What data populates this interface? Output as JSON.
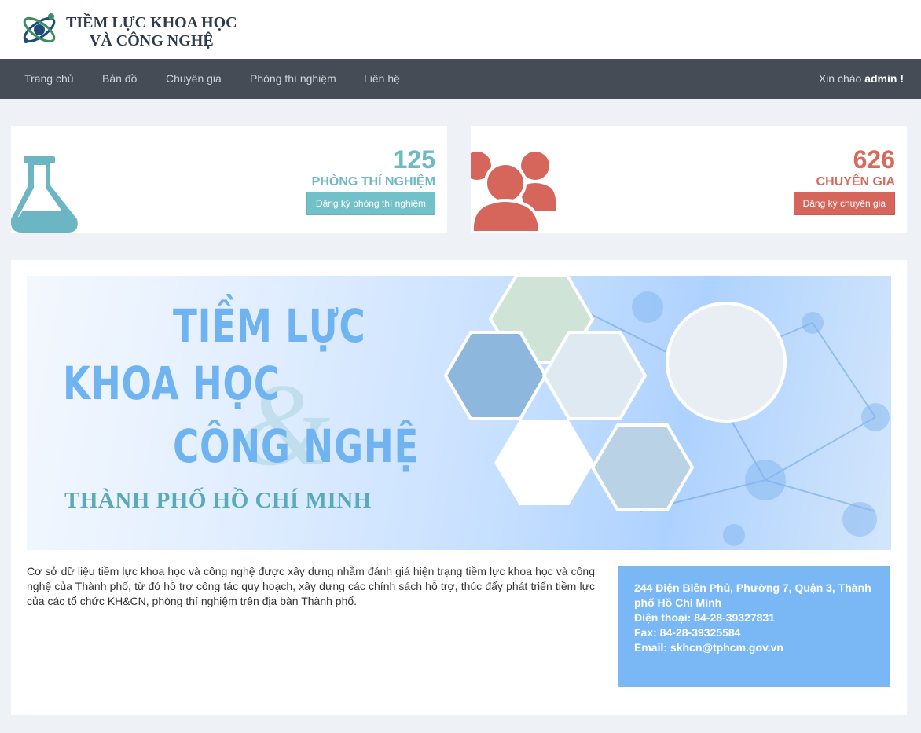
{
  "header": {
    "logo_line1": "TIỀM LỰC KHOA HỌC",
    "logo_line2": "VÀ CÔNG NGHỆ"
  },
  "nav": {
    "items": [
      {
        "label": "Trang chủ"
      },
      {
        "label": "Bản đồ"
      },
      {
        "label": "Chuyên gia"
      },
      {
        "label": "Phòng thí nghiệm"
      },
      {
        "label": "Liên hệ"
      }
    ],
    "greeting_prefix": "Xin chào",
    "username": "admin",
    "greeting_suffix": "!"
  },
  "stats": {
    "labs": {
      "count": "125",
      "label": "PHÒNG THÍ NGHIỆM",
      "button": "Đăng ký phòng thí nghiệm",
      "icon": "flask-icon",
      "color": "#6bbac4"
    },
    "experts": {
      "count": "626",
      "label": "CHUYÊN GIA",
      "button": "Đăng ký chuyên gia",
      "icon": "users-icon",
      "color": "#d86a5c"
    }
  },
  "banner": {
    "line1": "TIỀM LỰC",
    "line2": "KHOA HỌC",
    "line3": "CÔNG NGHỆ",
    "line4": "THÀNH PHỐ HỒ CHÍ MINH"
  },
  "description": "Cơ sở dữ liệu tiềm lực khoa học và công nghệ được xây dựng nhằm đánh giá hiện trạng tiềm lực khoa học và công nghệ của Thành phố, từ đó hỗ trợ công tác quy hoạch, xây dựng các chính sách hỗ trợ, thúc đẩy phát triển tiềm lực của các tổ chức KH&CN, phòng thí nghiệm trên địa bàn Thành phố.",
  "contact": {
    "address": "244 Điện Biên Phủ, Phường 7, Quận 3, Thành phố Hồ Chí Minh",
    "phone": "Điện thoại: 84-28-39327831",
    "fax": "Fax: 84-28-39325584",
    "email": "Email: skhcn@tphcm.gov.vn"
  },
  "colors": {
    "navbar": "#454c55",
    "lab_accent": "#72c1c9",
    "expert_accent": "#d6655c",
    "contact_box": "#7ab8f5"
  }
}
